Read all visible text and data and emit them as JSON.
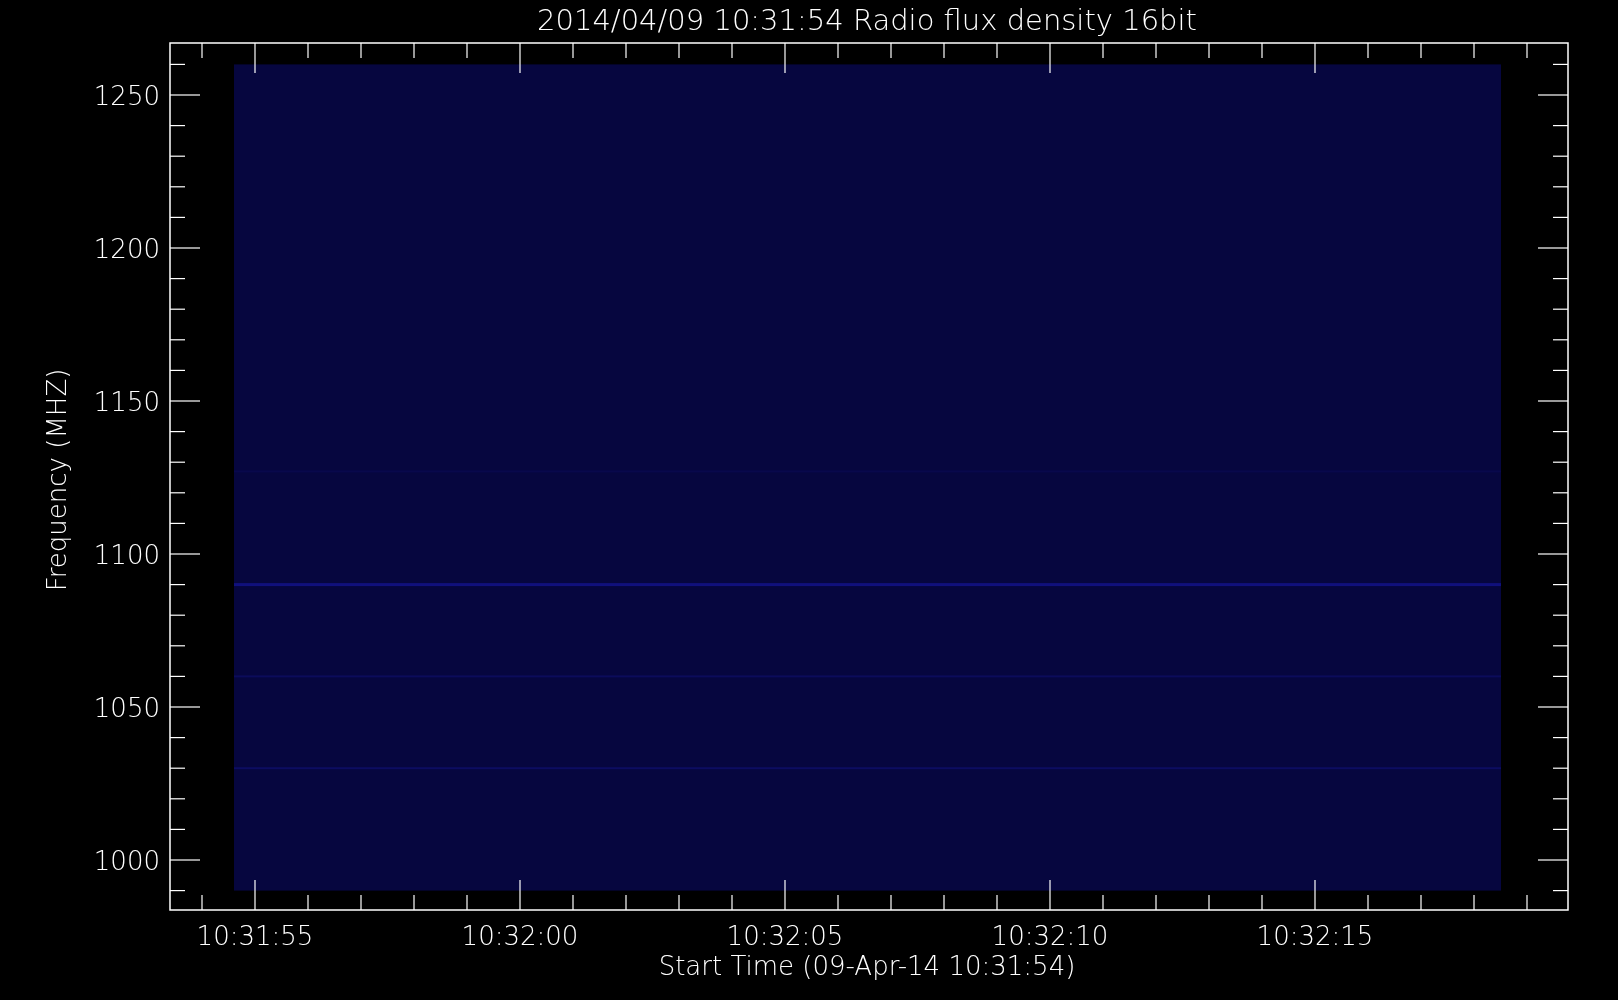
{
  "title": "2014/04/09 10:31:54 Radio flux density 16bit",
  "y_axis": {
    "title": "Frequency (MHZ)",
    "ticks": [
      "1250",
      "1200",
      "1150",
      "1100",
      "1050",
      "1000"
    ]
  },
  "x_axis": {
    "title": "Start Time (09-Apr-14 10:31:54)",
    "ticks": [
      "10:31:55",
      "10:32:00",
      "10:32:05",
      "10:32:10",
      "10:32:15"
    ]
  }
}
